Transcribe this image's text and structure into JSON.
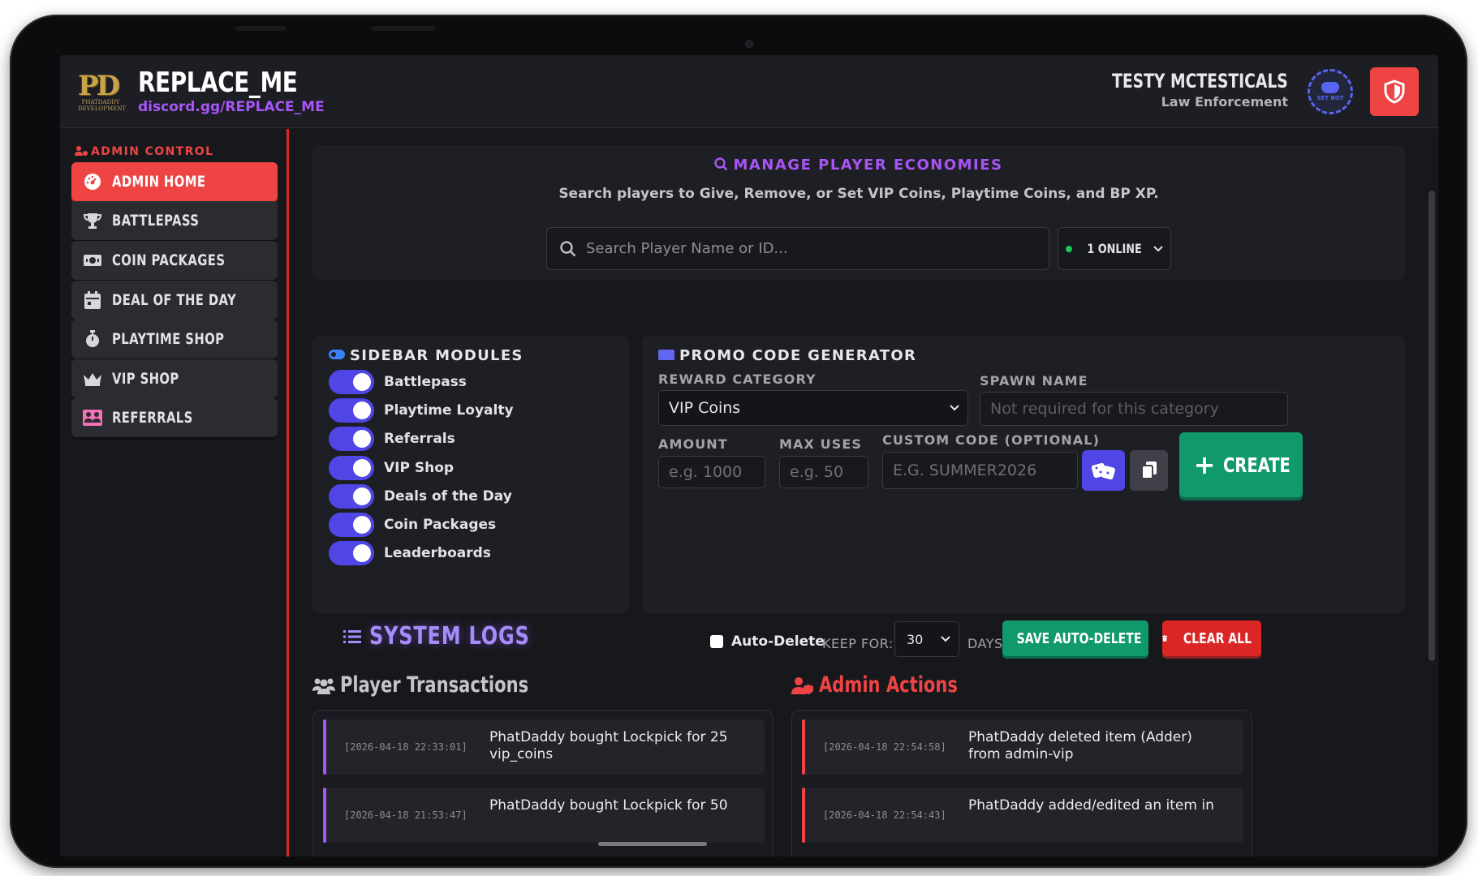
{
  "header": {
    "logo_text": "PD",
    "logo_sub": "PHATDADDY DEVELOPMENT",
    "title": "REPLACE_ME",
    "subtitle": "discord.gg/REPLACE_ME",
    "user_name": "TESTY MCTESTICALS",
    "user_role": "Law Enforcement",
    "discord_badge": "SET BOT",
    "shield_icon": "shield-icon"
  },
  "sidebar": {
    "heading": "ADMIN CONTROL",
    "items": [
      {
        "label": "ADMIN HOME",
        "icon": "dashboard-icon",
        "active": true
      },
      {
        "label": "BATTLEPASS",
        "icon": "trophy-icon"
      },
      {
        "label": "COIN PACKAGES",
        "icon": "money-icon"
      },
      {
        "label": "DEAL OF THE DAY",
        "icon": "calendar-icon"
      },
      {
        "label": "PLAYTIME SHOP",
        "icon": "stopwatch-icon"
      },
      {
        "label": "VIP SHOP",
        "icon": "crown-icon"
      },
      {
        "label": "REFERRALS",
        "icon": "users-icon"
      }
    ]
  },
  "economy": {
    "title": "MANAGE PLAYER ECONOMIES",
    "description": "Search players to Give, Remove, or Set VIP Coins, Playtime Coins, and BP XP.",
    "search_placeholder": "Search Player Name or ID...",
    "online_label": "1 ONLINE"
  },
  "modules": {
    "title": "SIDEBAR MODULES",
    "items": [
      {
        "label": "Battlepass",
        "enabled": true
      },
      {
        "label": "Playtime Loyalty",
        "enabled": true
      },
      {
        "label": "Referrals",
        "enabled": true
      },
      {
        "label": "VIP Shop",
        "enabled": true
      },
      {
        "label": "Deals of the Day",
        "enabled": true
      },
      {
        "label": "Coin Packages",
        "enabled": true
      },
      {
        "label": "Leaderboards",
        "enabled": true
      }
    ]
  },
  "promo": {
    "title": "PROMO CODE GENERATOR",
    "reward_category_label": "REWARD CATEGORY",
    "reward_category_value": "VIP Coins",
    "spawn_name_label": "SPAWN NAME",
    "spawn_name_placeholder": "Not required for this category",
    "amount_label": "AMOUNT",
    "amount_placeholder": "e.g. 1000",
    "max_uses_label": "MAX USES",
    "max_uses_placeholder": "e.g. 50",
    "custom_code_label": "CUSTOM CODE (OPTIONAL)",
    "custom_code_placeholder": "E.G. SUMMER2026",
    "create_label": "CREATE"
  },
  "logs": {
    "title": "SYSTEM LOGS",
    "auto_delete_label": "Auto-Delete",
    "auto_delete_checked": false,
    "keep_for_label": "KEEP FOR:",
    "keep_for_value": "30",
    "days_label": "DAYS",
    "save_label": "SAVE AUTO-DELETE",
    "clear_label": "CLEAR ALL",
    "player_heading": "Player Transactions",
    "admin_heading": "Admin Actions",
    "player_entries": [
      {
        "time": "[2026-04-18 22:33:01]",
        "message": "PhatDaddy bought Lockpick for 25 vip_coins"
      },
      {
        "time": "[2026-04-18 21:53:47]",
        "message": "PhatDaddy bought Lockpick for 50"
      }
    ],
    "admin_entries": [
      {
        "time": "[2026-04-18 22:54:58]",
        "message": "PhatDaddy deleted item (Adder) from admin-vip"
      },
      {
        "time": "[2026-04-18 22:54:43]",
        "message": "PhatDaddy added/edited an item in"
      }
    ]
  },
  "colors": {
    "accent_red": "#ef4444",
    "accent_purple": "#a855f7",
    "accent_green": "#10996a",
    "toggle_blue": "#4f46e5",
    "player_log_accent": "#a855f7",
    "admin_log_accent": "#ef4444"
  }
}
